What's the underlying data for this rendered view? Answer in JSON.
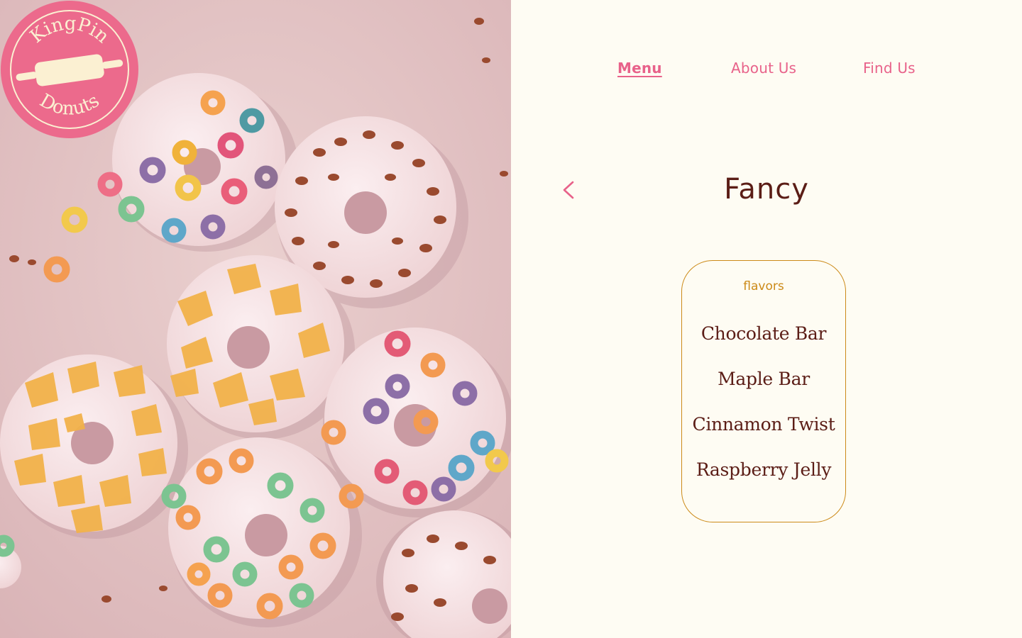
{
  "brand": {
    "logo_text_top": "KingPin",
    "logo_text_bottom": "Donuts",
    "logo_color": "#ec6a8c",
    "logo_cream": "#fbf0d2"
  },
  "nav": {
    "items": [
      {
        "label": "Menu",
        "active": true
      },
      {
        "label": "About Us",
        "active": false
      },
      {
        "label": "Find Us",
        "active": false
      }
    ],
    "color": "#e8628a"
  },
  "page": {
    "title": "Fancy",
    "back_icon": "chevron-left-icon"
  },
  "flavors_card": {
    "label": "flavors",
    "items": [
      "Chocolate Bar",
      "Maple Bar",
      "Cinnamon Twist",
      "Raspberry Jelly"
    ]
  },
  "colors": {
    "background": "#fefcf3",
    "title": "#5b1d16",
    "accent": "#cc8a18",
    "pink": "#e8628a"
  }
}
